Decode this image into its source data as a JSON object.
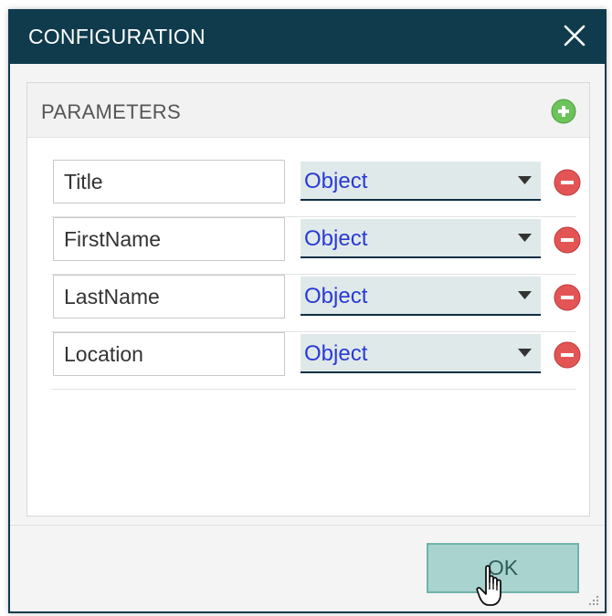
{
  "dialog": {
    "title": "CONFIGURATION",
    "close_icon": "close-icon",
    "title_bar_color": "#0f3b4c"
  },
  "parameters": {
    "header": "PARAMETERS",
    "add_icon": "plus-circle-icon",
    "remove_icon": "minus-circle-icon",
    "rows": [
      {
        "name": "Title",
        "type": "Object"
      },
      {
        "name": "FirstName",
        "type": "Object"
      },
      {
        "name": "LastName",
        "type": "Object"
      },
      {
        "name": "Location",
        "type": "Object"
      }
    ]
  },
  "footer": {
    "ok_label": "OK",
    "ok_color": "#a9d3cf"
  },
  "cursor": "hand-pointer-icon"
}
